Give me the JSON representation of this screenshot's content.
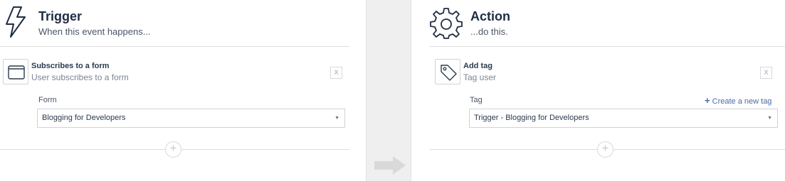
{
  "trigger": {
    "title": "Trigger",
    "subtitle": "When this event happens...",
    "icon": "lightning-icon",
    "step": {
      "title": "Subscribes to a form",
      "subtitle": "User subscribes to a form",
      "icon": "browser-window-icon",
      "close_label": "X"
    },
    "field": {
      "label": "Form",
      "value": "Blogging for Developers"
    },
    "add_label": "+"
  },
  "action": {
    "title": "Action",
    "subtitle": "...do this.",
    "icon": "gear-icon",
    "step": {
      "title": "Add tag",
      "subtitle": "Tag user",
      "icon": "tag-icon",
      "close_label": "X"
    },
    "field": {
      "label": "Tag",
      "value": "Trigger - Blogging for Developers"
    },
    "create_link": "Create a new tag",
    "add_label": "+"
  },
  "colors": {
    "text": "#2b3a4f",
    "link": "#4a6aa8",
    "divider_bg": "#efefef",
    "arrow": "#d9d9d9"
  }
}
